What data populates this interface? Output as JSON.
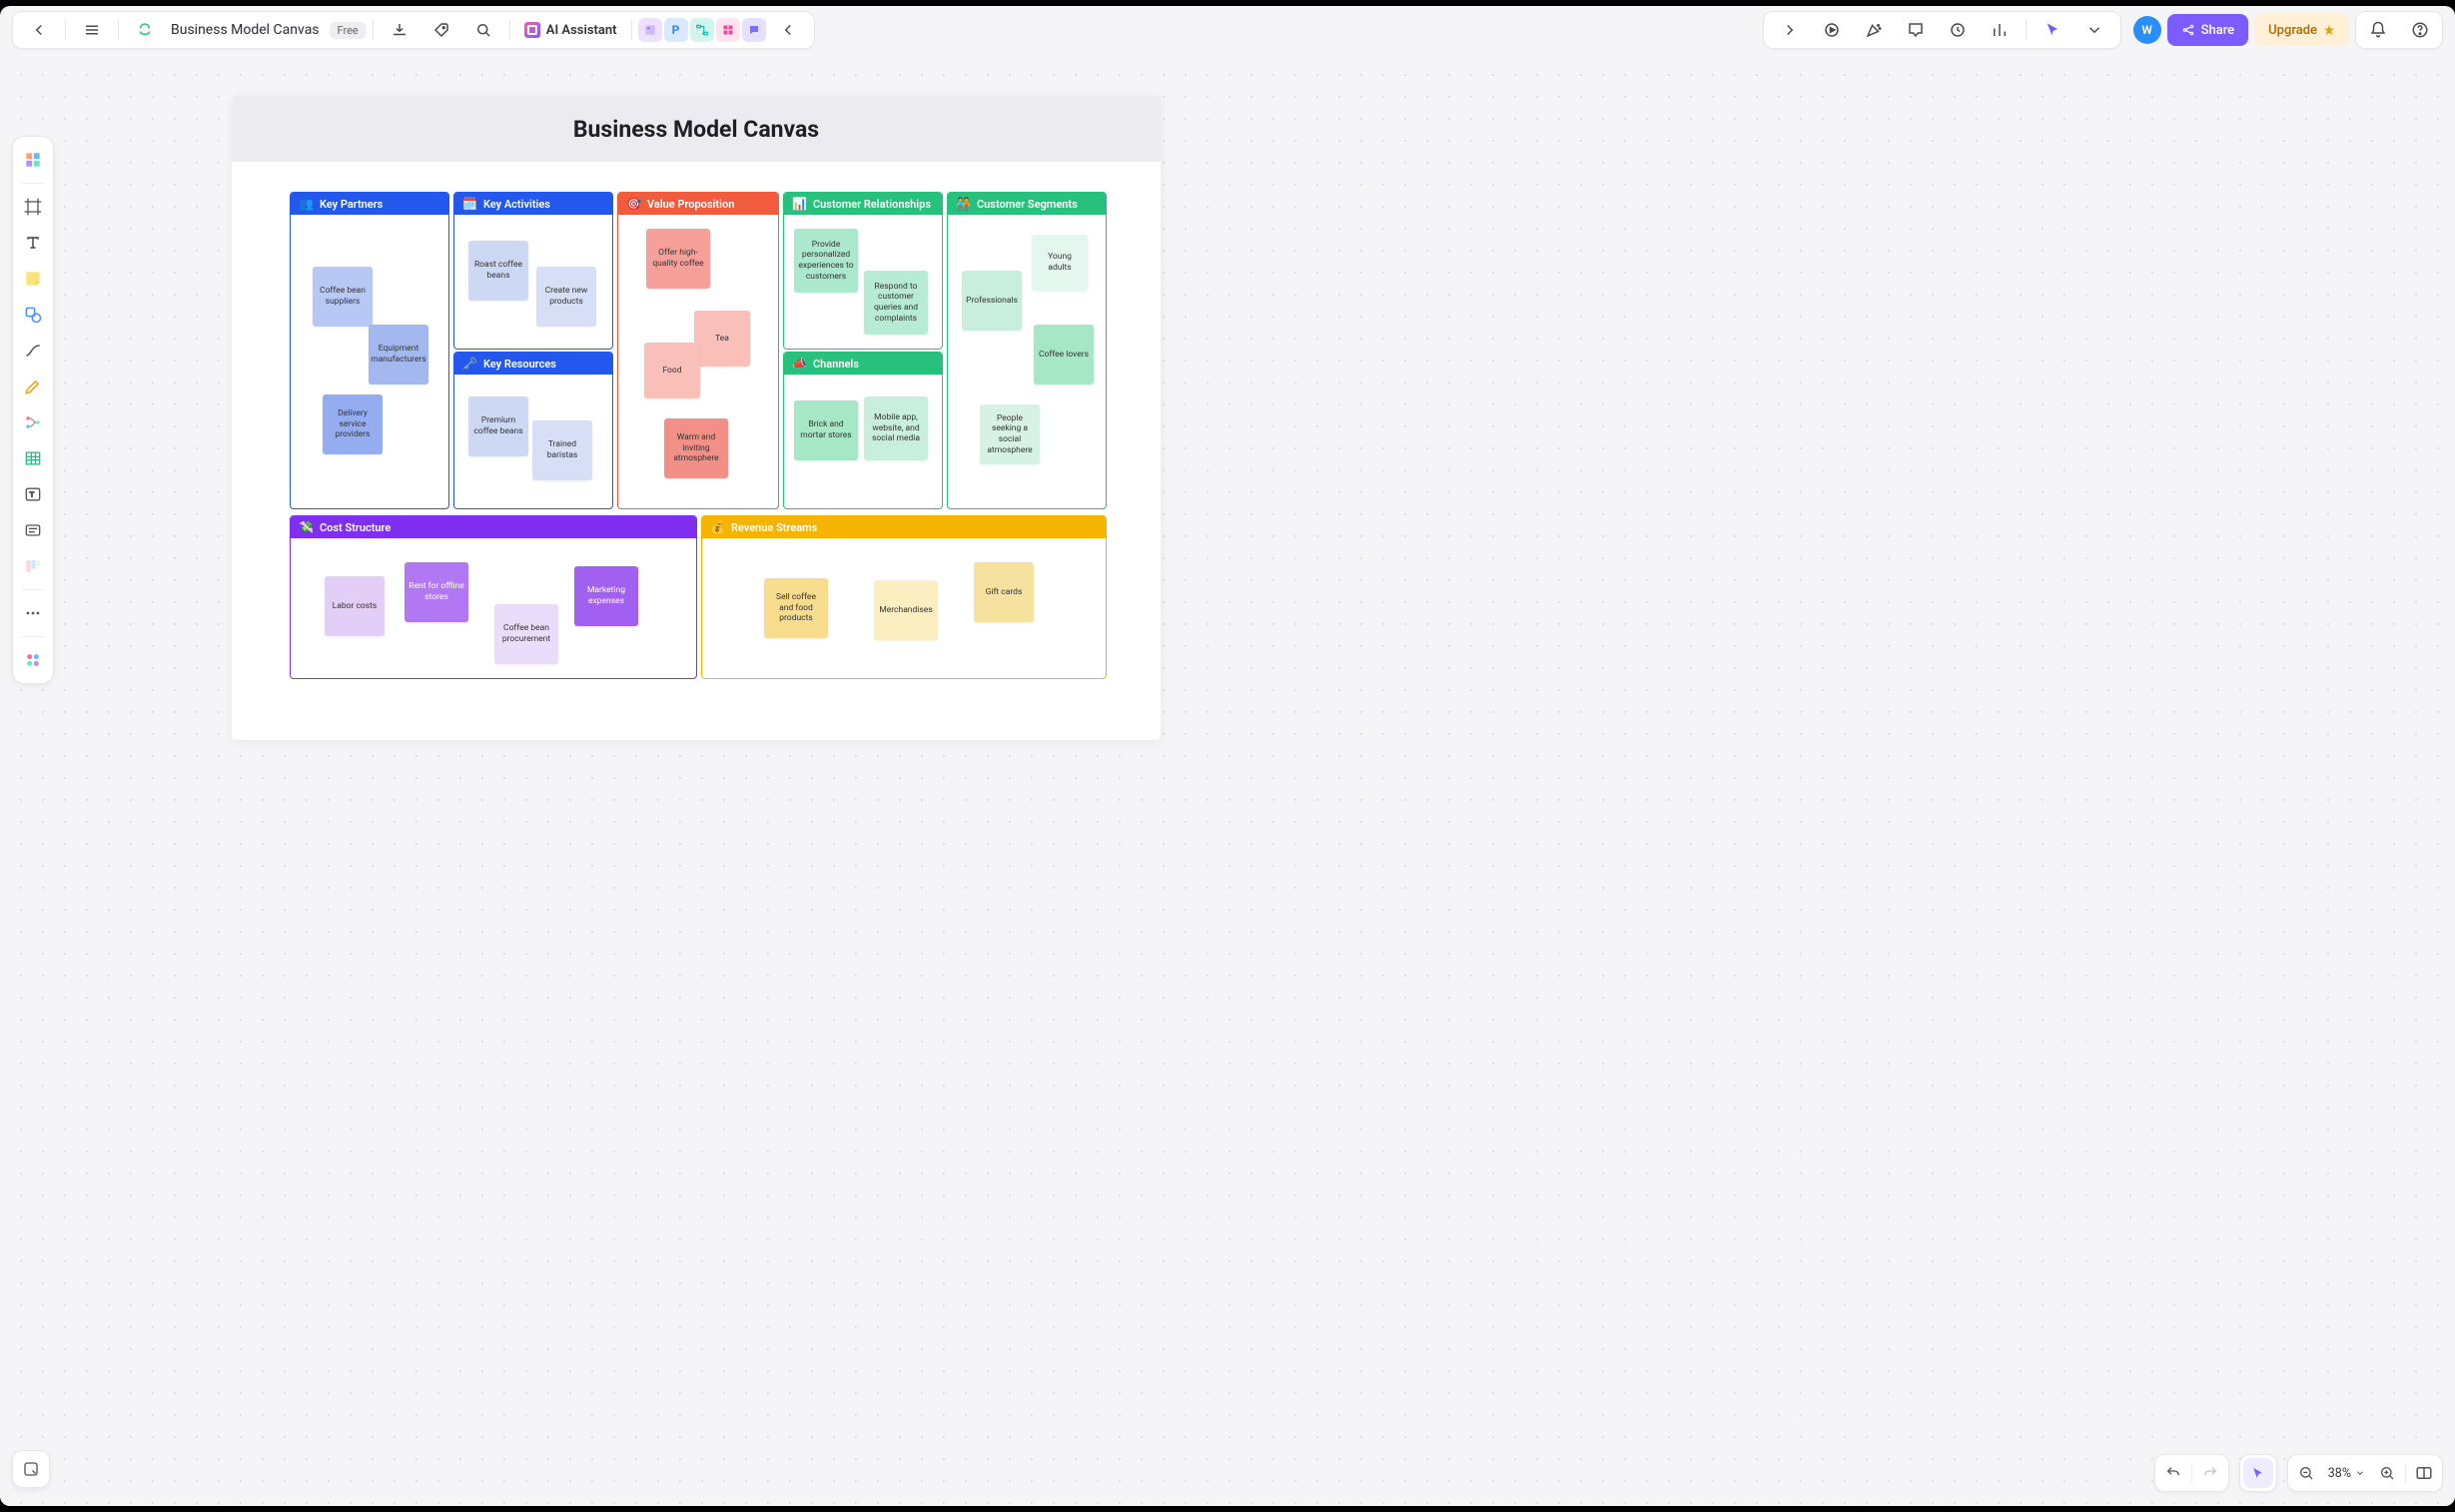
{
  "header": {
    "doc_name": "Business Model Canvas",
    "badge": "Free",
    "ai_label": "AI Assistant",
    "share_label": "Share",
    "upgrade_label": "Upgrade",
    "avatar_initial": "W"
  },
  "zoom": {
    "percent": "38%"
  },
  "board": {
    "title": "Business Model Canvas",
    "sections": {
      "partners": {
        "emoji": "👥",
        "label": "Key Partners"
      },
      "activities": {
        "emoji": "🗓️",
        "label": "Key Activities"
      },
      "resources": {
        "emoji": "🗝️",
        "label": "Key Resources"
      },
      "value": {
        "emoji": "🎯",
        "label": "Value Proposition"
      },
      "relationships": {
        "emoji": "📊",
        "label": "Customer Relationships"
      },
      "channels": {
        "emoji": "📣",
        "label": "Channels"
      },
      "segments": {
        "emoji": "🧑‍🤝‍🧑",
        "label": "Customer Segments"
      },
      "costs": {
        "emoji": "💸",
        "label": "Cost Structure"
      },
      "revenue": {
        "emoji": "💰",
        "label": "Revenue Streams"
      }
    },
    "notes": {
      "partners": [
        "Coffee bean suppliers",
        "Equipment manufacturers",
        "Delivery service providers"
      ],
      "activities": [
        "Roast coffee beans",
        "Create new products"
      ],
      "resources": [
        "Premium coffee beans",
        "Trained baristas"
      ],
      "value": [
        "Offer high-quality coffee",
        "Tea",
        "Food",
        "Warm and inviting atmosphere"
      ],
      "relationships": [
        "Provide personalized experiences to customers",
        "Respond to customer queries and complaints"
      ],
      "channels": [
        "Brick and mortar stores",
        "Mobile app, website, and social media"
      ],
      "segments": [
        "Young adults",
        "Professionals",
        "Coffee lovers",
        "People seeking a social atmosphere"
      ],
      "costs": [
        "Labor costs",
        "Rent for offline stores",
        "Coffee bean procurement",
        "Marketing expenses"
      ],
      "revenue": [
        "Sell coffee and food products",
        "Merchandises",
        "Gift cards"
      ]
    }
  }
}
